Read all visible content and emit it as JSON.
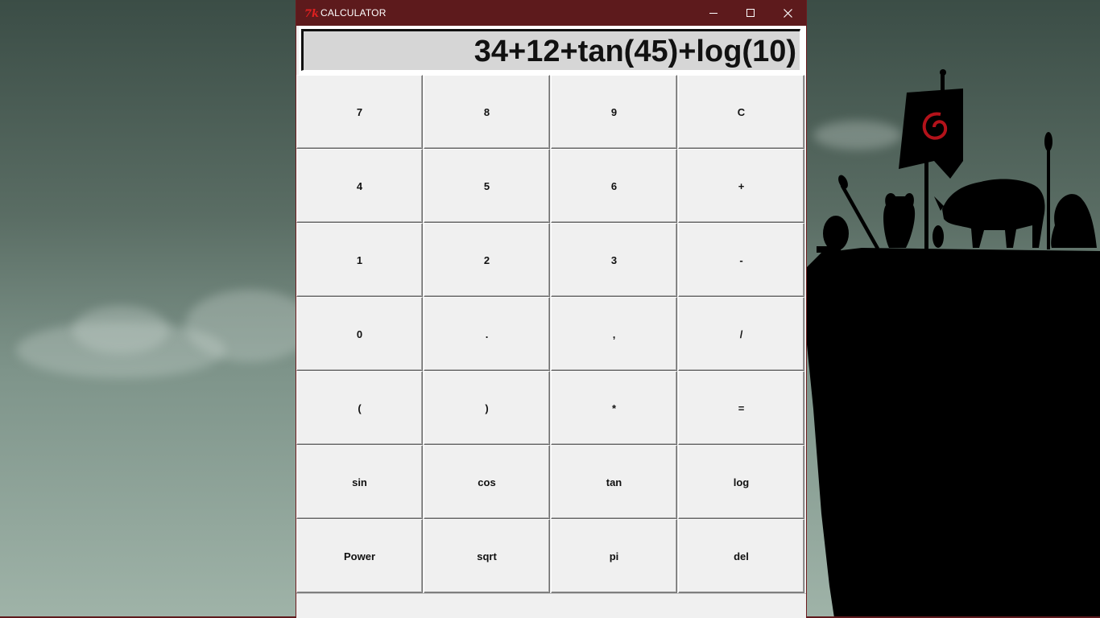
{
  "window": {
    "title": "CALCULATOR",
    "controls": {
      "minimize": "minimize-icon",
      "maximize": "maximize-icon",
      "close": "close-icon"
    }
  },
  "display": {
    "expression": "34+12+tan(45)+log(10)"
  },
  "keypad": {
    "rows": [
      [
        "7",
        "8",
        "9",
        "C"
      ],
      [
        "4",
        "5",
        "6",
        "+"
      ],
      [
        "1",
        "2",
        "3",
        "-"
      ],
      [
        "0",
        ".",
        ",",
        "/"
      ],
      [
        "(",
        ")",
        "*",
        "="
      ],
      [
        "sin",
        "cos",
        "tan",
        "log"
      ],
      [
        "Power",
        "sqrt",
        "pi",
        "del"
      ]
    ]
  },
  "colors": {
    "titlebar": "#5d1a1c",
    "window_bg": "#f0f0f0",
    "display_bg": "#d6d6d6",
    "desktop_top": "#3b4d46",
    "desktop_bottom": "#9fb3a8"
  }
}
